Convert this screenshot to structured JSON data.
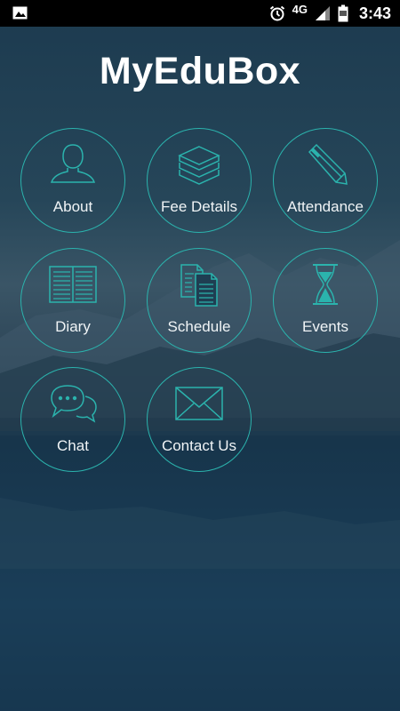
{
  "status_bar": {
    "network": "4G",
    "time": "3:43"
  },
  "app": {
    "title": "MyEduBox"
  },
  "menu": [
    {
      "label": "About",
      "icon": "person-icon"
    },
    {
      "label": "Fee Details",
      "icon": "layers-icon"
    },
    {
      "label": "Attendance",
      "icon": "pencil-icon"
    },
    {
      "label": "Diary",
      "icon": "open-book-icon"
    },
    {
      "label": "Schedule",
      "icon": "documents-icon"
    },
    {
      "label": "Events",
      "icon": "hourglass-icon"
    },
    {
      "label": "Chat",
      "icon": "chat-bubbles-icon"
    },
    {
      "label": "Contact Us",
      "icon": "envelope-icon"
    }
  ],
  "colors": {
    "accent": "#2bb3ad",
    "status_bar": "#000000"
  }
}
